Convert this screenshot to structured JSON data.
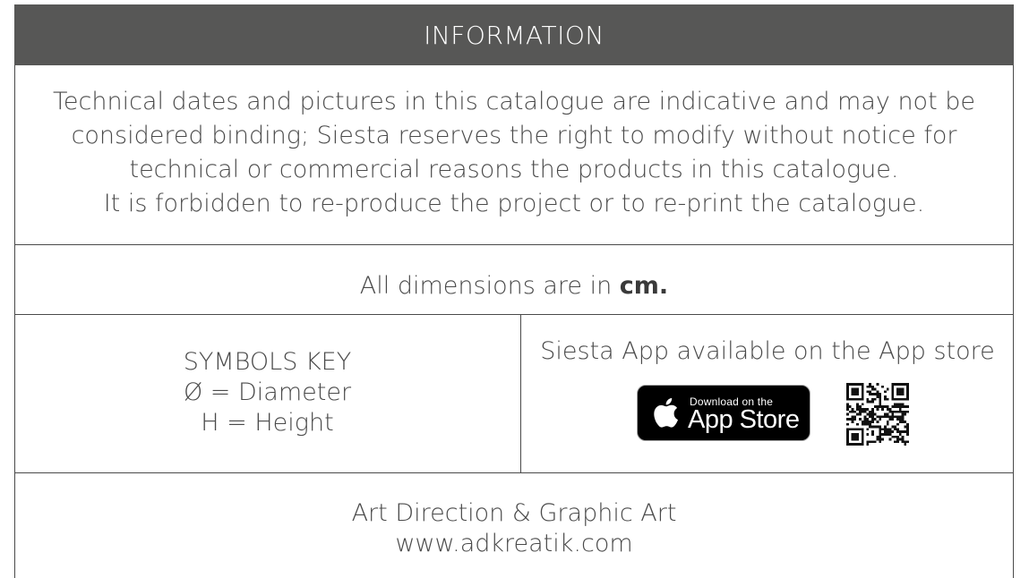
{
  "header": {
    "title": "INFORMATION"
  },
  "disclaimer": {
    "lines": [
      "Technical dates and pictures in this catalogue are indicative and may not be",
      "considered binding; Siesta reserves the right to modify without notice for",
      "technical or commercial reasons the products in this catalogue.",
      "It is forbidden to re-produce the project or to re-print the catalogue."
    ]
  },
  "dimensions": {
    "text": "All dimensions are in ",
    "unit": "cm."
  },
  "symbols": {
    "title": "SYMBOLS KEY",
    "items": [
      "Ø = Diameter",
      "H = Height"
    ]
  },
  "app": {
    "title": "Siesta App available on the App store",
    "badge_small": "Download on the",
    "badge_big": "App Store",
    "badge_icon": "apple-icon",
    "qr_icon": "qr-code-icon"
  },
  "credits": {
    "line1": "Art Direction & Graphic Art",
    "line2": "www.adkreatik.com"
  },
  "colors": {
    "header_bg": "#575756",
    "text": "#4a4a4a",
    "badge_bg": "#000000"
  }
}
